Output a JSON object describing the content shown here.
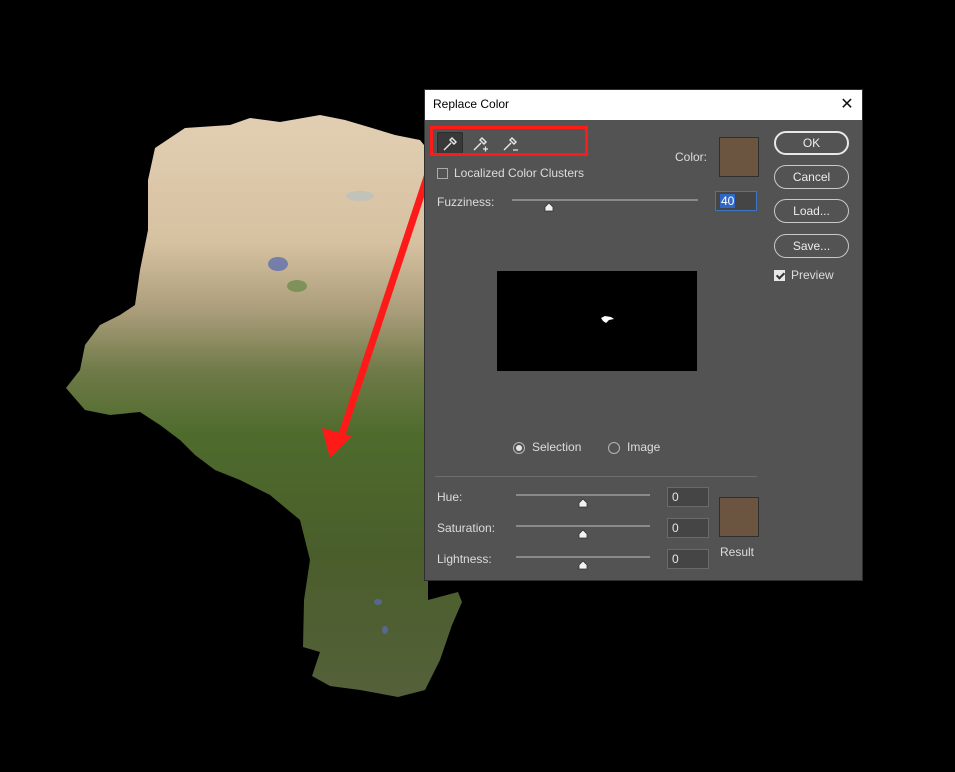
{
  "dialog": {
    "title": "Replace Color",
    "close_glyph": "✕",
    "eyedroppers": [
      {
        "icon": "eyedropper-icon",
        "active": true
      },
      {
        "icon": "eyedropper-plus-icon",
        "active": false
      },
      {
        "icon": "eyedropper-minus-icon",
        "active": false
      }
    ],
    "color_label": "Color:",
    "color_swatch": "#6b5540",
    "localized_label": "Localized Color Clusters",
    "localized_checked": false,
    "fuzziness": {
      "label": "Fuzziness:",
      "value": "40",
      "max": 200
    },
    "view_options": [
      {
        "label": "Selection",
        "checked": true
      },
      {
        "label": "Image",
        "checked": false
      }
    ],
    "hue": {
      "label": "Hue:",
      "value": "0"
    },
    "saturation": {
      "label": "Saturation:",
      "value": "0"
    },
    "lightness": {
      "label": "Lightness:",
      "value": "0"
    },
    "result_label": "Result",
    "result_swatch": "#6b5540",
    "buttons": {
      "ok": "OK",
      "cancel": "Cancel",
      "load": "Load...",
      "save": "Save..."
    },
    "preview": {
      "label": "Preview",
      "checked": true
    }
  },
  "colors": {
    "dialog_bg": "#535353",
    "highlight": "#ff1a1a",
    "arrow": "#ff1a1a",
    "desert": "#d8c4a6",
    "vegetation": "#4f6a2e"
  }
}
